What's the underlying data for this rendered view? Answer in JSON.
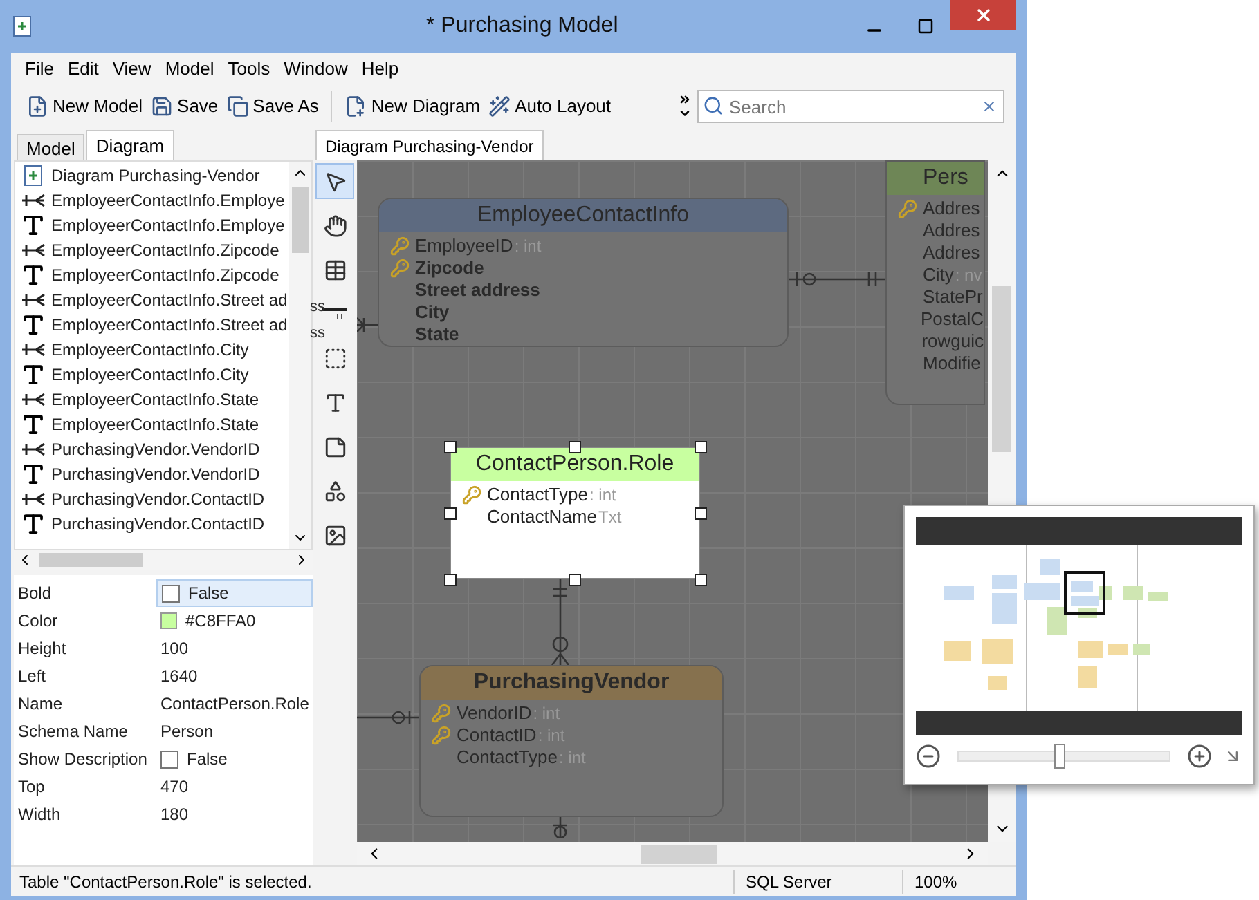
{
  "window": {
    "title": "* Purchasing Model"
  },
  "menu": [
    "File",
    "Edit",
    "View",
    "Model",
    "Tools",
    "Window",
    "Help"
  ],
  "toolbar": [
    {
      "kind": "new-model",
      "label": "New Model"
    },
    {
      "kind": "save",
      "label": "Save"
    },
    {
      "kind": "save-as",
      "label": "Save As"
    },
    {
      "kind": "new-diagram",
      "label": "New Diagram"
    },
    {
      "kind": "auto-layout",
      "label": "Auto Layout"
    }
  ],
  "search": {
    "placeholder": "Search"
  },
  "left_tabs": [
    {
      "label": "Model",
      "selected": false
    },
    {
      "label": "Diagram",
      "selected": true
    }
  ],
  "tree": [
    {
      "kind": "diagram",
      "label": "Diagram Purchasing-Vendor"
    },
    {
      "kind": "relation",
      "label": "EmployeerContactInfo.Employe"
    },
    {
      "kind": "text",
      "label": "EmployeerContactInfo.Employe"
    },
    {
      "kind": "relation",
      "label": "EmployeerContactInfo.Zipcode"
    },
    {
      "kind": "text",
      "label": "EmployeerContactInfo.Zipcode"
    },
    {
      "kind": "relation",
      "label": "EmployeerContactInfo.Street ad"
    },
    {
      "kind": "text",
      "label": "EmployeerContactInfo.Street ad"
    },
    {
      "kind": "relation",
      "label": "EmployeerContactInfo.City"
    },
    {
      "kind": "text",
      "label": "EmployeerContactInfo.City"
    },
    {
      "kind": "relation",
      "label": "EmployeerContactInfo.State"
    },
    {
      "kind": "text",
      "label": "EmployeerContactInfo.State"
    },
    {
      "kind": "relation",
      "label": "PurchasingVendor.VendorID"
    },
    {
      "kind": "text",
      "label": "PurchasingVendor.VendorID"
    },
    {
      "kind": "relation",
      "label": "PurchasingVendor.ContactID"
    },
    {
      "kind": "text",
      "label": "PurchasingVendor.ContactID"
    }
  ],
  "tree_overflow": [
    "ss",
    "ss"
  ],
  "properties": [
    {
      "name": "Bold",
      "kind": "checkbox",
      "value": "False",
      "checked": false,
      "selected": true
    },
    {
      "name": "Color",
      "kind": "color",
      "value": "#C8FFA0",
      "color": "#c8ffa0",
      "selected": false
    },
    {
      "name": "Height",
      "kind": "text",
      "value": "100",
      "selected": false
    },
    {
      "name": "Left",
      "kind": "text",
      "value": "1640",
      "selected": false
    },
    {
      "name": "Name",
      "kind": "text",
      "value": "ContactPerson.Role",
      "selected": false
    },
    {
      "name": "Schema Name",
      "kind": "text",
      "value": "Person",
      "selected": false
    },
    {
      "name": "Show Description",
      "kind": "checkbox",
      "value": "False",
      "checked": false,
      "selected": false
    },
    {
      "name": "Top",
      "kind": "text",
      "value": "470",
      "selected": false
    },
    {
      "name": "Width",
      "kind": "text",
      "value": "180",
      "selected": false
    }
  ],
  "toolbox": [
    {
      "kind": "pointer",
      "selected": true
    },
    {
      "kind": "hand",
      "selected": false
    },
    {
      "kind": "table",
      "selected": false
    },
    {
      "kind": "relation",
      "selected": false
    },
    {
      "kind": "view",
      "selected": false
    },
    {
      "kind": "text",
      "selected": false
    },
    {
      "kind": "note",
      "selected": false
    },
    {
      "kind": "shape",
      "selected": false
    },
    {
      "kind": "image",
      "selected": false
    }
  ],
  "diagram_tab": {
    "label": "Diagram Purchasing-Vendor"
  },
  "entities": [
    {
      "name": "EmployeeContactInfo",
      "color": "#5d6a80",
      "selected": false,
      "fields": [
        {
          "name": "EmployeeID",
          "type": ": int",
          "key": true,
          "bold": false
        },
        {
          "name": "Zipcode",
          "key": true,
          "bold": true
        },
        {
          "name": "Street address",
          "key": false,
          "bold": true
        },
        {
          "name": "City",
          "key": false,
          "bold": true
        },
        {
          "name": "State",
          "key": false,
          "bold": true
        }
      ]
    },
    {
      "name": "Pers",
      "color": "#6e8656",
      "selected": false,
      "fields": [
        {
          "name": "Addres",
          "key": true,
          "bold": false
        },
        {
          "name": "Addres",
          "key": false,
          "bold": false
        },
        {
          "name": "Addres",
          "key": false,
          "bold": false
        },
        {
          "name": "City",
          "type": ": nv",
          "key": false,
          "bold": false
        },
        {
          "name": "StatePr",
          "key": false,
          "bold": false
        },
        {
          "name": "PostalC",
          "key": false,
          "bold": false
        },
        {
          "name": "rowguic",
          "key": false,
          "bold": false
        },
        {
          "name": "Modifie",
          "key": false,
          "bold": false
        }
      ]
    },
    {
      "name": "ContactPerson.Role",
      "color": "#c8ffa0",
      "selected": true,
      "fields": [
        {
          "name": "ContactType",
          "type": ": int",
          "key": true,
          "bold": false
        },
        {
          "name": "ContactName",
          "type": "Txt",
          "key": false,
          "bold": false
        }
      ]
    },
    {
      "name": "PurchasingVendor",
      "color": "#86714e",
      "selected": false,
      "fields": [
        {
          "name": "VendorID",
          "type": ": int",
          "key": true,
          "bold": false
        },
        {
          "name": "ContactID",
          "type": ": int",
          "key": true,
          "bold": false
        },
        {
          "name": "ContactType",
          "type": ": int",
          "key": false,
          "bold": false
        }
      ]
    }
  ],
  "overview": {
    "level": 0.48
  },
  "status_bar": {
    "message": "Table \"ContactPerson.Role\" is selected.",
    "database": "SQL Server",
    "zoom": "100%"
  }
}
